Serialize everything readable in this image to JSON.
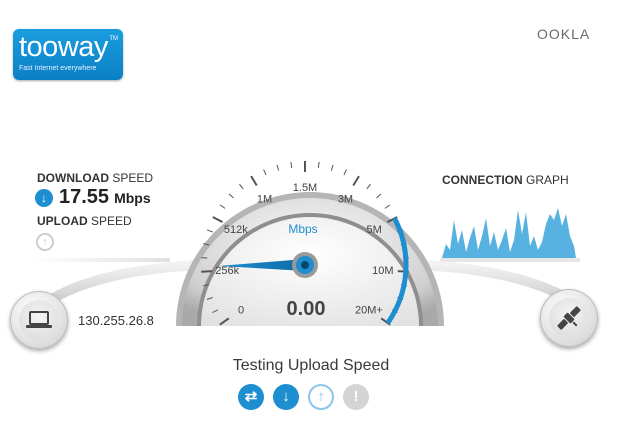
{
  "brand": {
    "logo_text": "tooway",
    "logo_tm": "TM",
    "logo_tagline": "Fast Internet everywhere",
    "partner_logo": "OOKLA"
  },
  "download": {
    "label_bold": "DOWNLOAD",
    "label_rest": " SPEED",
    "value": "17.55",
    "unit": "Mbps",
    "icon": "arrow-down-icon"
  },
  "upload": {
    "label_bold": "UPLOAD",
    "label_rest": " SPEED",
    "icon": "arrow-up-icon"
  },
  "connection_graph": {
    "label_bold": "CONNECTION",
    "label_rest": " GRAPH",
    "color": "#3aa5dd"
  },
  "gauge": {
    "unit_label": "Mbps",
    "reading": "0.00",
    "ticks": [
      "0",
      "256k",
      "512k",
      "1M",
      "1.5M",
      "3M",
      "5M",
      "10M",
      "20M+"
    ],
    "needle_tick_index": 1.1,
    "accent": "#1d8fd0"
  },
  "client": {
    "ip": "130.255.26.8",
    "icon": "laptop-icon"
  },
  "server": {
    "icon": "satellite-icon"
  },
  "status": {
    "text": "Testing Upload Speed",
    "steps": [
      {
        "name": "ping-step-icon",
        "glyph": "⇄",
        "state": "done"
      },
      {
        "name": "download-step-icon",
        "glyph": "↓",
        "state": "done"
      },
      {
        "name": "upload-step-icon",
        "glyph": "↑",
        "state": "active"
      },
      {
        "name": "result-step-icon",
        "glyph": "!",
        "state": "pending"
      }
    ]
  }
}
